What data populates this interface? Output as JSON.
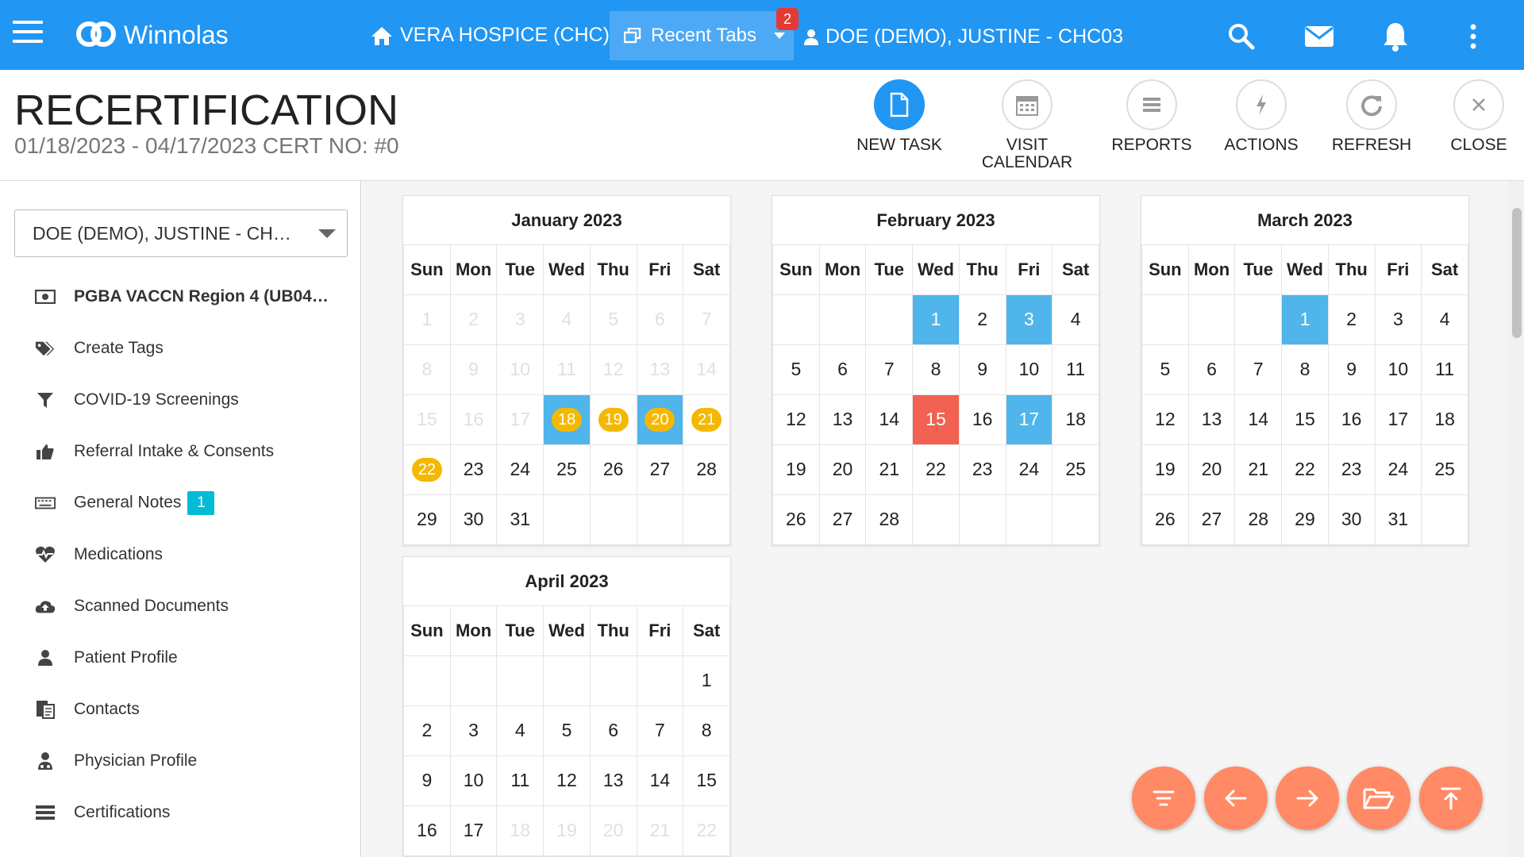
{
  "topbar": {
    "brand": "Winnolas",
    "agency": "VERA HOSPICE (CHC)",
    "recent_tabs_label": "Recent Tabs",
    "recent_tabs_count": "2",
    "patient": "DOE (DEMO), JUSTINE - CHC03",
    "color": "#2196f3"
  },
  "header": {
    "title": "RECERTIFICATION",
    "subtitle": "01/18/2023 - 04/17/2023 CERT NO: #0",
    "actions": [
      {
        "label": "NEW TASK",
        "icon": "document-icon"
      },
      {
        "label": "VISIT CALENDAR",
        "icon": "calendar-icon"
      },
      {
        "label": "REPORTS",
        "icon": "list-icon"
      },
      {
        "label": "ACTIONS",
        "icon": "bolt-icon"
      },
      {
        "label": "REFRESH",
        "icon": "refresh-icon"
      },
      {
        "label": "CLOSE",
        "icon": "close-icon"
      }
    ]
  },
  "sidebar": {
    "selected_patient": "DOE (DEMO), JUSTINE - CH…",
    "items": [
      {
        "label": "PGBA VACCN Region 4 (UB04…",
        "icon": "money-icon"
      },
      {
        "label": "Create Tags",
        "icon": "tags-icon"
      },
      {
        "label": "COVID-19 Screenings",
        "icon": "filter-icon"
      },
      {
        "label": "Referral Intake & Consents",
        "icon": "thumbs-up-icon"
      },
      {
        "label": "General Notes",
        "icon": "keyboard-icon",
        "count": "1"
      },
      {
        "label": "Medications",
        "icon": "heartbeat-icon"
      },
      {
        "label": "Scanned Documents",
        "icon": "cloud-upload-icon"
      },
      {
        "label": "Patient Profile",
        "icon": "user-icon"
      },
      {
        "label": "Contacts",
        "icon": "contacts-icon"
      },
      {
        "label": "Physician Profile",
        "icon": "physician-icon"
      },
      {
        "label": "Certifications",
        "icon": "certifications-icon"
      }
    ]
  },
  "calendar": {
    "weekdays": [
      "Sun",
      "Mon",
      "Tue",
      "Wed",
      "Thu",
      "Fri",
      "Sat"
    ],
    "colors": {
      "visit": "#4fb5eb",
      "missed": "#f26151",
      "scheduled": "#f5b800"
    },
    "months": [
      {
        "title": "January 2023",
        "weeks": [
          [
            {
              "d": "1",
              "s": "dim"
            },
            {
              "d": "2",
              "s": "dim"
            },
            {
              "d": "3",
              "s": "dim"
            },
            {
              "d": "4",
              "s": "dim"
            },
            {
              "d": "5",
              "s": "dim"
            },
            {
              "d": "6",
              "s": "dim"
            },
            {
              "d": "7",
              "s": "dim"
            }
          ],
          [
            {
              "d": "8",
              "s": "dim"
            },
            {
              "d": "9",
              "s": "dim"
            },
            {
              "d": "10",
              "s": "dim"
            },
            {
              "d": "11",
              "s": "dim"
            },
            {
              "d": "12",
              "s": "dim"
            },
            {
              "d": "13",
              "s": "dim"
            },
            {
              "d": "14",
              "s": "dim"
            }
          ],
          [
            {
              "d": "15",
              "s": "dim"
            },
            {
              "d": "16",
              "s": "dim"
            },
            {
              "d": "17",
              "s": "dim"
            },
            {
              "d": "18",
              "s": "blue-dot"
            },
            {
              "d": "19",
              "s": "dot"
            },
            {
              "d": "20",
              "s": "blue-dot"
            },
            {
              "d": "21",
              "s": "dot"
            }
          ],
          [
            {
              "d": "22",
              "s": "dot"
            },
            {
              "d": "23"
            },
            {
              "d": "24"
            },
            {
              "d": "25"
            },
            {
              "d": "26"
            },
            {
              "d": "27"
            },
            {
              "d": "28"
            }
          ],
          [
            {
              "d": "29"
            },
            {
              "d": "30"
            },
            {
              "d": "31"
            },
            {
              "d": ""
            },
            {
              "d": ""
            },
            {
              "d": ""
            },
            {
              "d": ""
            }
          ]
        ]
      },
      {
        "title": "February 2023",
        "weeks": [
          [
            {
              "d": ""
            },
            {
              "d": ""
            },
            {
              "d": ""
            },
            {
              "d": "1",
              "s": "blue"
            },
            {
              "d": "2"
            },
            {
              "d": "3",
              "s": "blue"
            },
            {
              "d": "4"
            }
          ],
          [
            {
              "d": "5"
            },
            {
              "d": "6"
            },
            {
              "d": "7"
            },
            {
              "d": "8"
            },
            {
              "d": "9"
            },
            {
              "d": "10"
            },
            {
              "d": "11"
            }
          ],
          [
            {
              "d": "12"
            },
            {
              "d": "13"
            },
            {
              "d": "14"
            },
            {
              "d": "15",
              "s": "red"
            },
            {
              "d": "16"
            },
            {
              "d": "17",
              "s": "blue"
            },
            {
              "d": "18"
            }
          ],
          [
            {
              "d": "19"
            },
            {
              "d": "20"
            },
            {
              "d": "21"
            },
            {
              "d": "22"
            },
            {
              "d": "23"
            },
            {
              "d": "24"
            },
            {
              "d": "25"
            }
          ],
          [
            {
              "d": "26"
            },
            {
              "d": "27"
            },
            {
              "d": "28"
            },
            {
              "d": ""
            },
            {
              "d": ""
            },
            {
              "d": ""
            },
            {
              "d": ""
            }
          ]
        ]
      },
      {
        "title": "March 2023",
        "weeks": [
          [
            {
              "d": ""
            },
            {
              "d": ""
            },
            {
              "d": ""
            },
            {
              "d": "1",
              "s": "blue"
            },
            {
              "d": "2"
            },
            {
              "d": "3"
            },
            {
              "d": "4"
            }
          ],
          [
            {
              "d": "5"
            },
            {
              "d": "6"
            },
            {
              "d": "7"
            },
            {
              "d": "8"
            },
            {
              "d": "9"
            },
            {
              "d": "10"
            },
            {
              "d": "11"
            }
          ],
          [
            {
              "d": "12"
            },
            {
              "d": "13"
            },
            {
              "d": "14"
            },
            {
              "d": "15"
            },
            {
              "d": "16"
            },
            {
              "d": "17"
            },
            {
              "d": "18"
            }
          ],
          [
            {
              "d": "19"
            },
            {
              "d": "20"
            },
            {
              "d": "21"
            },
            {
              "d": "22"
            },
            {
              "d": "23"
            },
            {
              "d": "24"
            },
            {
              "d": "25"
            }
          ],
          [
            {
              "d": "26"
            },
            {
              "d": "27"
            },
            {
              "d": "28"
            },
            {
              "d": "29"
            },
            {
              "d": "30"
            },
            {
              "d": "31"
            },
            {
              "d": ""
            }
          ]
        ]
      },
      {
        "title": "April 2023",
        "weeks": [
          [
            {
              "d": ""
            },
            {
              "d": ""
            },
            {
              "d": ""
            },
            {
              "d": ""
            },
            {
              "d": ""
            },
            {
              "d": ""
            },
            {
              "d": "1"
            }
          ],
          [
            {
              "d": "2"
            },
            {
              "d": "3"
            },
            {
              "d": "4"
            },
            {
              "d": "5"
            },
            {
              "d": "6"
            },
            {
              "d": "7"
            },
            {
              "d": "8"
            }
          ],
          [
            {
              "d": "9"
            },
            {
              "d": "10"
            },
            {
              "d": "11"
            },
            {
              "d": "12"
            },
            {
              "d": "13"
            },
            {
              "d": "14"
            },
            {
              "d": "15"
            }
          ],
          [
            {
              "d": "16"
            },
            {
              "d": "17"
            },
            {
              "d": "18",
              "s": "dim"
            },
            {
              "d": "19",
              "s": "dim"
            },
            {
              "d": "20",
              "s": "dim"
            },
            {
              "d": "21",
              "s": "dim"
            },
            {
              "d": "22",
              "s": "dim"
            }
          ]
        ]
      }
    ]
  },
  "fabs": [
    {
      "icon": "filter-lines-icon"
    },
    {
      "icon": "arrow-left-icon"
    },
    {
      "icon": "arrow-right-icon"
    },
    {
      "icon": "folder-open-icon"
    },
    {
      "icon": "scroll-top-icon"
    }
  ]
}
